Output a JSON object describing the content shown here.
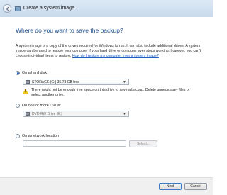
{
  "window": {
    "title": "Create a system image"
  },
  "heading": "Where do you want to save the backup?",
  "description": {
    "text": "A system image is a copy of the drives required for Windows to run. It can also include additional drives. A system image can be used to restore your computer if your hard drive or computer ever stops working; however, you can't choose individual items to restore.",
    "link": "How do I restore my computer from a system image?"
  },
  "options": {
    "hard_disk": {
      "label": "On a hard disk",
      "selected_value": "STORAGE (G:)  35.73 GB free",
      "warning": "There might not be enough free space on this drive to save a backup. Delete unnecessary files or select another drive."
    },
    "dvd": {
      "label": "On one or more DVDs:",
      "selected_value": "DVD RW Drive (E:)"
    },
    "network": {
      "label": "On a network location",
      "input_value": "",
      "select_button": "Select..."
    }
  },
  "buttons": {
    "next": "Next",
    "cancel": "Cancel"
  }
}
